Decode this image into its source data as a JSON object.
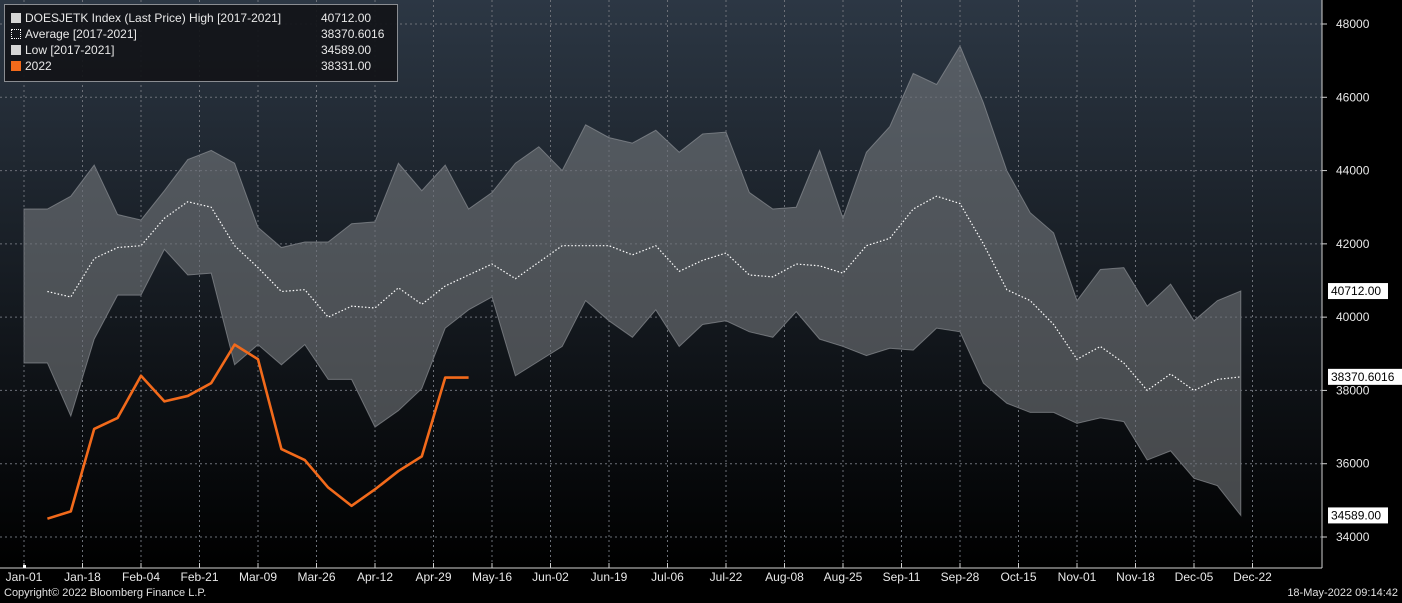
{
  "colors": {
    "background_top": "#2c3744",
    "background_bottom": "#000000",
    "band_fill": "#7c7f84",
    "low_fill": "#3b3e43",
    "average_line": "#ffffff",
    "current_line": "#f26a1b",
    "grid": "#6c7078",
    "text": "#e8e8e8"
  },
  "legend": [
    {
      "label": "DOESJETK Index (Last Price) High [2017-2021]",
      "value": "40712.00",
      "swatch": "solid-light"
    },
    {
      "label": "Average  [2017-2021]",
      "value": "38370.6016",
      "swatch": "dotted"
    },
    {
      "label": "Low  [2017-2021]",
      "value": "34589.00",
      "swatch": "solid-light"
    },
    {
      "label": "2022",
      "value": "38331.00",
      "swatch": "orange"
    }
  ],
  "footer": {
    "copyright": "Copyright© 2022 Bloomberg Finance L.P.",
    "timestamp": "18-May-2022 09:14:42"
  },
  "chart_data": {
    "type": "area",
    "grid": true,
    "legend_position": "top-left",
    "y_axis_side": "right",
    "ylim": [
      33500,
      48500
    ],
    "y_ticks": [
      34000,
      36000,
      38000,
      40000,
      42000,
      44000,
      46000,
      48000
    ],
    "y_tick_labels": [
      "34000",
      "36000",
      "38000",
      "40000",
      "42000",
      "44000",
      "46000",
      "48000"
    ],
    "x_tick_labels": [
      "Jan-01",
      "Jan-18",
      "Feb-04",
      "Feb-21",
      "Mar-09",
      "Mar-26",
      "Apr-12",
      "Apr-29",
      "May-16",
      "Jun-02",
      "Jun-19",
      "Jul-06",
      "Jul-22",
      "Aug-08",
      "Aug-25",
      "Sep-11",
      "Sep-28",
      "Oct-15",
      "Nov-01",
      "Nov-18",
      "Dec-05",
      "Dec-22"
    ],
    "week_positions": [
      1,
      2,
      3,
      4,
      5,
      6,
      7,
      8,
      9,
      10,
      11,
      12,
      13,
      14,
      15,
      16,
      17,
      18,
      19,
      20,
      21,
      22,
      23,
      24,
      25,
      26,
      27,
      28,
      29,
      30,
      31,
      32,
      33,
      34,
      35,
      36,
      37,
      38,
      39,
      40,
      41,
      42,
      43,
      44,
      45,
      46,
      47,
      48,
      49,
      50,
      51,
      52
    ],
    "series": [
      {
        "name": "DOESJETK Index (Last Price) High [2017-2021]",
        "values": [
          42950,
          42950,
          43300,
          44150,
          42800,
          42650,
          43450,
          44300,
          44550,
          44200,
          42450,
          41900,
          42050,
          42050,
          42550,
          42600,
          44200,
          43450,
          44150,
          42950,
          43400,
          44200,
          44650,
          44000,
          45250,
          44900,
          44750,
          45100,
          44500,
          45000,
          45050,
          43400,
          42950,
          43000,
          44550,
          42700,
          44500,
          45200,
          46650,
          46350,
          47400,
          45850,
          44000,
          42850,
          42300,
          40450,
          41300,
          41350,
          40300,
          40900,
          39900,
          40450,
          40712
        ]
      },
      {
        "name": "Average  [2017-2021]",
        "values": [
          null,
          40700,
          40550,
          41600,
          41900,
          41950,
          42700,
          43150,
          43000,
          41950,
          41350,
          40700,
          40750,
          40000,
          40300,
          40250,
          40800,
          40350,
          40850,
          41150,
          41450,
          41050,
          41500,
          41950,
          41950,
          41950,
          41700,
          41950,
          41250,
          41550,
          41750,
          41150,
          41100,
          41450,
          41400,
          41200,
          41950,
          42150,
          42950,
          43300,
          43100,
          42000,
          40750,
          40450,
          39800,
          38850,
          39200,
          38750,
          38000,
          38450,
          38000,
          38300,
          38370.6
        ]
      },
      {
        "name": "Low  [2017-2021]",
        "values": [
          38750,
          38750,
          37300,
          39400,
          40600,
          40600,
          41850,
          41150,
          41200,
          38700,
          39250,
          38700,
          39250,
          38300,
          38300,
          37000,
          37450,
          38050,
          39700,
          40200,
          40550,
          38400,
          38800,
          39200,
          40450,
          39900,
          39450,
          40200,
          39200,
          39800,
          39900,
          39600,
          39450,
          40150,
          39400,
          39200,
          38950,
          39150,
          39100,
          39700,
          39600,
          38200,
          37650,
          37400,
          37400,
          37100,
          37250,
          37150,
          36100,
          36350,
          35600,
          35400,
          34589
        ]
      },
      {
        "name": "2022",
        "values": [
          null,
          34500,
          34700,
          36950,
          37250,
          38400,
          37700,
          37850,
          38200,
          39250,
          38850,
          36400,
          36100,
          35350,
          34850,
          35300,
          35800,
          36200,
          38350,
          38350
        ]
      }
    ]
  },
  "right_axis_labels": {
    "high": "40712.00",
    "average": "38370.6016",
    "low": "34589.00"
  }
}
